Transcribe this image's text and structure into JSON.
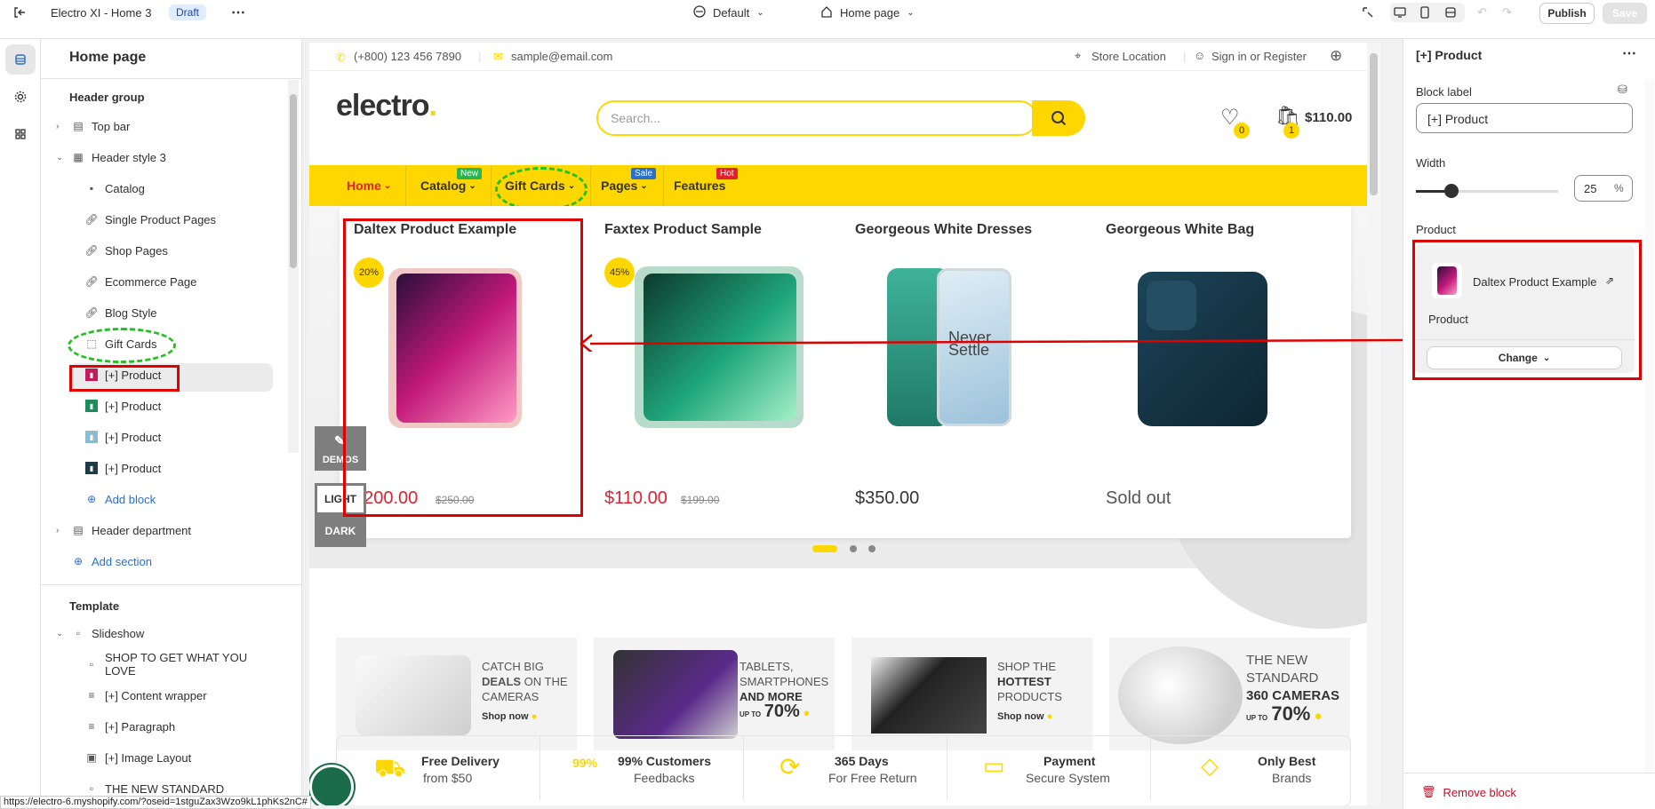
{
  "topbar": {
    "store_title": "Electro XI - Home 3",
    "status_badge": "Draft",
    "theme_select": "Default",
    "page_select": "Home page",
    "publish_label": "Publish",
    "save_label": "Save"
  },
  "left_panel": {
    "title": "Home page",
    "header_group_label": "Header group",
    "items": [
      {
        "label": "Top bar",
        "icon": "layout-icon"
      },
      {
        "label": "Header style 3",
        "icon": "section-icon"
      },
      {
        "label": "Catalog",
        "icon": "image-icon"
      },
      {
        "label": "Single Product Pages",
        "icon": "link-icon"
      },
      {
        "label": "Shop Pages",
        "icon": "link-icon"
      },
      {
        "label": "Ecommerce Page",
        "icon": "link-icon"
      },
      {
        "label": "Blog Style",
        "icon": "link-icon"
      },
      {
        "label": "Gift Cards",
        "icon": "dashed-square-icon"
      },
      {
        "label": "[+] Product",
        "icon": "product-thumb-icon"
      },
      {
        "label": "[+] Product",
        "icon": "product-thumb-icon"
      },
      {
        "label": "[+] Product",
        "icon": "product-thumb-icon"
      },
      {
        "label": "[+] Product",
        "icon": "product-thumb-icon"
      },
      {
        "label": "Add block",
        "icon": "plus-circle-icon"
      },
      {
        "label": "Header department",
        "icon": "layout-icon"
      },
      {
        "label": "Add section",
        "icon": "plus-circle-icon"
      }
    ],
    "template_label": "Template",
    "template_items": [
      {
        "label": "Slideshow"
      },
      {
        "label": "SHOP TO GET WHAT YOU LOVE"
      },
      {
        "label": "[+] Content wrapper"
      },
      {
        "label": "[+] Paragraph"
      },
      {
        "label": "[+] Image Layout"
      },
      {
        "label": "THE NEW STANDARD"
      }
    ]
  },
  "preview": {
    "topbar": {
      "phone": "(+800) 123 456 7890",
      "email": "sample@email.com",
      "store_location": "Store Location",
      "sign_in": "Sign in or Register"
    },
    "logo": "electro",
    "search_placeholder": "Search...",
    "wishlist_count": "0",
    "cart_count": "1",
    "cart_total": "$110.00",
    "nav": [
      {
        "label": "Home",
        "badge": ""
      },
      {
        "label": "Catalog",
        "badge": "New"
      },
      {
        "label": "Gift Cards",
        "badge": ""
      },
      {
        "label": "Pages",
        "badge": "Sale"
      },
      {
        "label": "Features",
        "badge": "Hot"
      }
    ],
    "products": [
      {
        "title": "Daltex Product Example",
        "discount": "20%",
        "price": "$200.00",
        "old_price": "$250.00"
      },
      {
        "title": "Faxtex Product Sample",
        "discount": "45%",
        "price": "$110.00",
        "old_price": "$199.00"
      },
      {
        "title": "Georgeous White Dresses",
        "discount": "",
        "price": "$350.00",
        "old_price": ""
      },
      {
        "title": "Georgeous White Bag",
        "discount": "",
        "price": "Sold out",
        "old_price": ""
      }
    ],
    "phone_screen_text_1": "Never",
    "phone_screen_text_2": "Settle",
    "demos_label": "DEMOS",
    "light_label": "LIGHT",
    "dark_label": "DARK",
    "promos": [
      {
        "l1": "CATCH BIG",
        "l2": "DEALS",
        "l2b": " ON THE",
        "l3": "CAMERAS",
        "cta": "Shop now"
      },
      {
        "l1": "TABLETS,",
        "l2": "SMARTPHONES",
        "l3": "AND MORE",
        "up": "UP TO",
        "pct": "70%"
      },
      {
        "l1": "SHOP THE",
        "l2": "HOTTEST",
        "l3": "PRODUCTS",
        "cta": "Shop now"
      },
      {
        "l1": "THE NEW",
        "l2": "STANDARD",
        "l3": "360 CAMERAS",
        "up": "UP TO",
        "pct": "70%"
      }
    ],
    "features": [
      {
        "a": "Free Delivery",
        "b": "from $50"
      },
      {
        "a": "99% Customers",
        "b": "Feedbacks",
        "icon_text": "99%"
      },
      {
        "a": "365 Days",
        "b": "For Free Return"
      },
      {
        "a": "Payment",
        "b": "Secure System"
      },
      {
        "a": "Only Best",
        "b": "Brands"
      }
    ]
  },
  "right_panel": {
    "title": "[+] Product",
    "block_label_title": "Block label",
    "block_label_value": "[+] Product",
    "width_title": "Width",
    "width_value": "25",
    "width_unit": "%",
    "width_fraction": 0.25,
    "product_title": "Product",
    "product_name": "Daltex Product Example",
    "product_type": "Product",
    "change_label": "Change",
    "remove_label": "Remove block"
  },
  "status_url": "https://electro-6.myshopify.com/?oseid=1stguZax3Wzo9kL1phKs2nC#",
  "colors": {
    "accent": "#fed700",
    "sale_red": "#e3202f",
    "annotation_red": "#e00000",
    "annotation_green": "#21c21f",
    "link_blue": "#2c6ecb"
  }
}
